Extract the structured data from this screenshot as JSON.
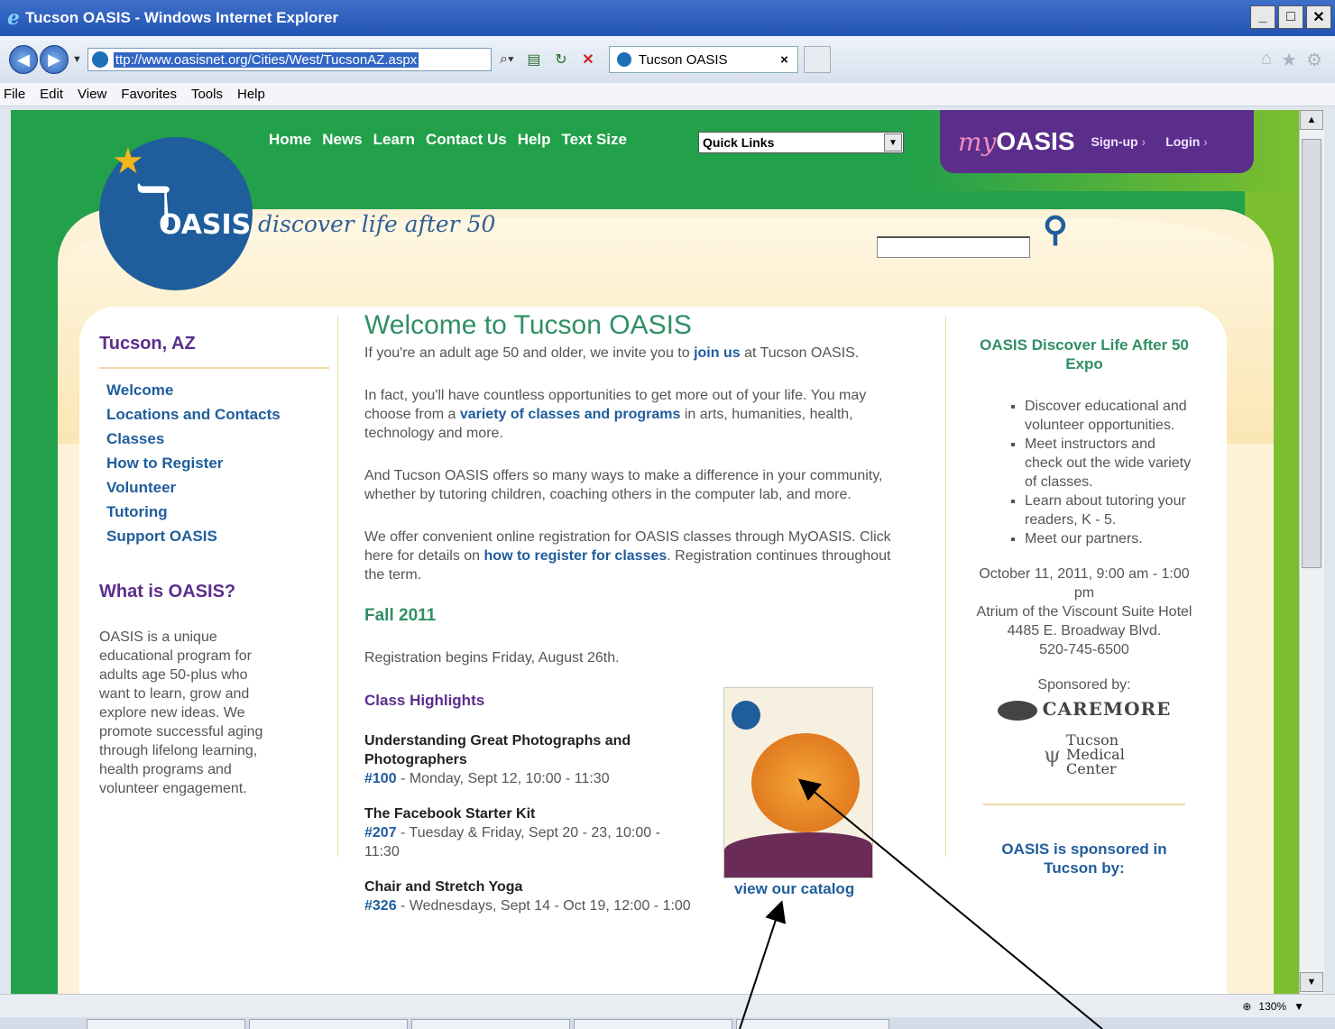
{
  "window": {
    "title": "Tucson OASIS - Windows Internet Explorer"
  },
  "browser": {
    "url": "ttp://www.oasisnet.org/Cities/West/TucsonAZ.aspx",
    "tab_title": "Tucson OASIS",
    "tab_close": "×",
    "zoom": "130%"
  },
  "menu": [
    "File",
    "Edit",
    "View",
    "Favorites",
    "Tools",
    "Help"
  ],
  "site": {
    "logo_text": "OASIS",
    "tagline": "discover life after 50",
    "nav": [
      "Home",
      "News",
      "Learn",
      "Contact Us",
      "Help",
      "Text Size"
    ],
    "quick_links": "Quick Links",
    "myoasis": {
      "my": "my",
      "oasis": "OASIS",
      "signup": "Sign-up",
      "login": "Login"
    },
    "search": {
      "placeholder": ""
    }
  },
  "left": {
    "city": "Tucson, AZ",
    "links": [
      "Welcome",
      "Locations and Contacts",
      "Classes",
      "How to Register",
      "Volunteer",
      "Tutoring",
      "Support OASIS"
    ],
    "what_title": "What is OASIS?",
    "what_text": "OASIS is a unique educational program for adults age 50-plus who want to learn, grow and explore new ideas. We promote successful aging through lifelong learning, health programs and volunteer engagement."
  },
  "main": {
    "title": "Welcome to Tucson OASIS",
    "p1_a": "If you're an adult age 50 and older, we invite you to ",
    "p1_link": "join us",
    "p1_b": " at Tucson OASIS.",
    "p2_a": "In fact, you'll have countless opportunities to get more out of your life. You may choose from a ",
    "p2_link": "variety of classes and programs",
    "p2_b": " in arts, humanities, health, technology and more.",
    "p3": "And Tucson OASIS offers so many ways to make a difference in your community, whether by tutoring children, coaching others in the computer lab, and more.",
    "p4_a": "We offer convenient online registration for OASIS classes through MyOASIS. Click here for details on ",
    "p4_link": "how to register for classes",
    "p4_b": ". Registration continues throughout the term.",
    "fall_title": "Fall 2011",
    "reg_text": "Registration begins Friday, August 26th.",
    "highlights_title": "Class Highlights",
    "courses": [
      {
        "title": "Understanding Great Photographs and Photographers",
        "num": "#100",
        "when": " - Monday, Sept 12, 10:00 - 11:30"
      },
      {
        "title": "The Facebook Starter Kit",
        "num": "#207",
        "when": " - Tuesday & Friday, Sept 20 - 23, 10:00 - 11:30"
      },
      {
        "title": "Chair and Stretch Yoga",
        "num": "#326",
        "when": " - Wednesdays, Sept 14 - Oct 19, 12:00 - 1:00"
      }
    ],
    "catalog_link": "view our catalog"
  },
  "right": {
    "expo_title": "OASIS Discover Life After 50 Expo",
    "bullets": [
      "Discover educational and volunteer opportunities.",
      "Meet instructors and check out the wide variety of classes.",
      "Learn about tutoring your readers, K - 5.",
      "Meet our partners."
    ],
    "when": "October 11, 2011, 9:00 am - 1:00 pm",
    "where": "Atrium of the Viscount Suite Hotel",
    "address": "4485 E. Broadway Blvd.",
    "phone": "520-745-6500",
    "sponsored_by": "Sponsored by:",
    "sponsor1": "CAREMORE",
    "sponsor2_l1": "Tucson",
    "sponsor2_l2": "Medical",
    "sponsor2_l3": "Center",
    "sponsored_tucson": "OASIS is sponsored in Tucson by:"
  },
  "colors": {
    "green": "#23a04a",
    "purple": "#5b2e8c",
    "link_blue": "#1f5d9c",
    "cream": "#fdf2d8"
  }
}
